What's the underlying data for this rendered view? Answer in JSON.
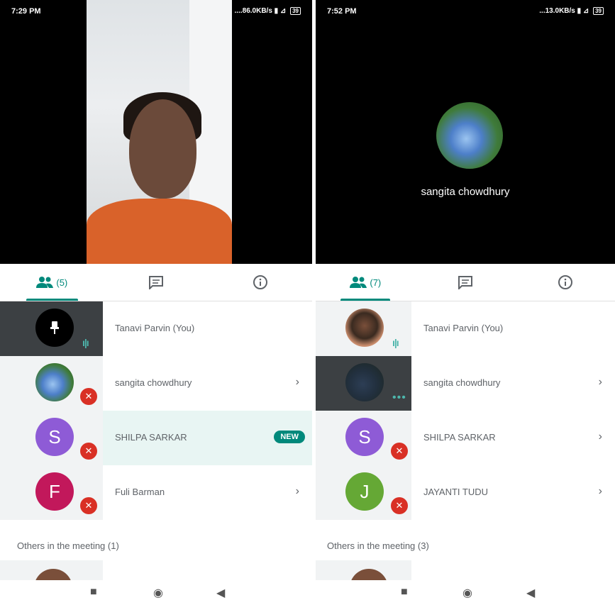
{
  "left": {
    "status": {
      "time": "7:29 PM",
      "net": "....86.0KB/s",
      "battery": "39"
    },
    "tabs": {
      "people_count": "(5)"
    },
    "participants": [
      {
        "name": "Tanavi Parvin (You)",
        "avatar": "pin-icon",
        "state": "speaking"
      },
      {
        "name": "sangita chowdhury",
        "avatar": "photo",
        "state": "muted"
      },
      {
        "name": "SHILPA SARKAR",
        "initial": "S",
        "state": "muted",
        "badge": "NEW"
      },
      {
        "name": "Fuli Barman",
        "initial": "F",
        "state": "muted"
      }
    ],
    "others_label": "Others in the meeting (1)"
  },
  "right": {
    "status": {
      "time": "7:52 PM",
      "net": "...13.0KB/s",
      "battery": "39"
    },
    "main_name": "sangita chowdhury",
    "tabs": {
      "people_count": "(7)"
    },
    "participants": [
      {
        "name": "Tanavi Parvin (You)",
        "avatar": "photo",
        "state": "speaking"
      },
      {
        "name": "sangita chowdhury",
        "avatar": "photo-dim",
        "state": "connecting"
      },
      {
        "name": "SHILPA SARKAR",
        "initial": "S",
        "state": "muted"
      },
      {
        "name": "JAYANTI TUDU",
        "initial": "J",
        "state": "muted"
      }
    ],
    "others_label": "Others in the meeting (3)"
  },
  "icons": {
    "chevron": "›",
    "mic_off": "✕",
    "speaking": "ı|ı",
    "dots": "•••"
  },
  "colors": {
    "accent": "#00897b",
    "mute": "#d93025"
  }
}
